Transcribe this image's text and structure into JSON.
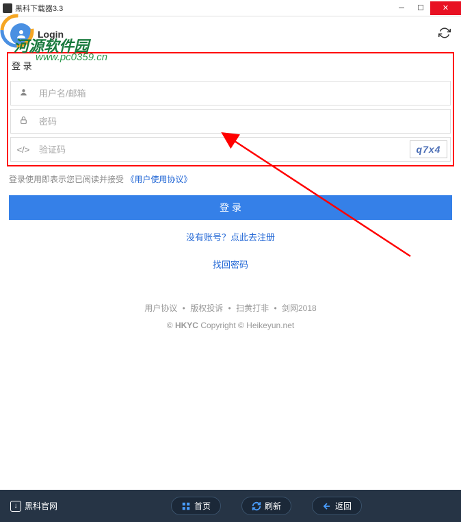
{
  "titlebar": {
    "title": "黑科下载器3.3"
  },
  "watermark": {
    "text": "河源软件园",
    "url": "www.pc0359.cn"
  },
  "header": {
    "title": "Login"
  },
  "login": {
    "panel_title": "登 录",
    "username_placeholder": "用户名/邮箱",
    "password_placeholder": "密码",
    "captcha_placeholder": "验证码",
    "captcha_value": "q7x4",
    "agreement_prefix": "登录使用即表示您已阅读并接受",
    "agreement_link": "《用户使用协议》",
    "login_button": "登 录",
    "register_link": "没有账号？点此去注册",
    "forgot_link": "找回密码"
  },
  "footer": {
    "links": [
      "用户协议",
      "版权投诉",
      "扫黄打非",
      "剑网2018"
    ],
    "copyright_prefix": "©",
    "copyright_name": "HKYC",
    "copyright_text": "Copyright © Heikeyun.net"
  },
  "bottom_bar": {
    "official": "黑科官网",
    "home": "首页",
    "refresh": "刷新",
    "back": "返回"
  }
}
